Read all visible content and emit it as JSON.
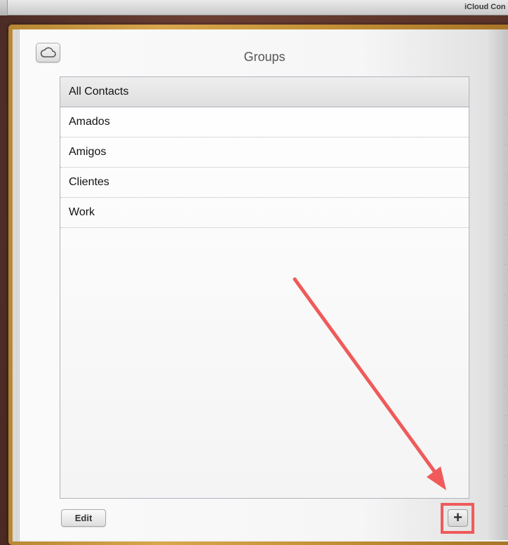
{
  "window": {
    "title": "iCloud Con"
  },
  "groups": {
    "title": "Groups",
    "items": [
      {
        "label": "All Contacts",
        "selected": true
      },
      {
        "label": "Amados",
        "selected": false
      },
      {
        "label": "Amigos",
        "selected": false
      },
      {
        "label": "Clientes",
        "selected": false
      },
      {
        "label": "Work",
        "selected": false
      }
    ]
  },
  "toolbar": {
    "edit_label": "Edit",
    "add_label": "+"
  },
  "icons": {
    "cloud": "cloud-icon"
  },
  "colors": {
    "annotation": "#f05a5a"
  }
}
